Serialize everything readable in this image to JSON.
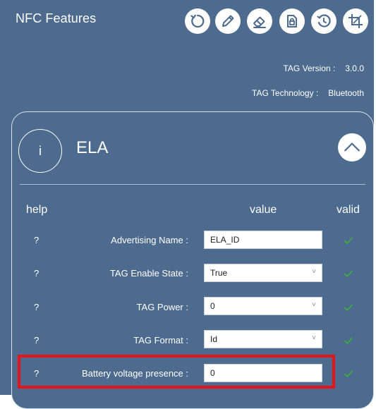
{
  "app": {
    "title": "NFC Features"
  },
  "toolbar": {
    "buttons": [
      {
        "icon": "refresh-icon"
      },
      {
        "icon": "pencil-icon"
      },
      {
        "icon": "eraser-icon"
      },
      {
        "icon": "lock-file-icon"
      },
      {
        "icon": "clock-refresh-icon"
      },
      {
        "icon": "crop-icon"
      }
    ]
  },
  "tag_info": {
    "version_label": "TAG Version :",
    "version_value": "3.0.0",
    "technology_label": "TAG Technology :",
    "technology_value": "Bluetooth"
  },
  "section": {
    "info_symbol": "i",
    "title": "ELA"
  },
  "columns": {
    "help": "help",
    "value": "value",
    "valid": "valid"
  },
  "rows": [
    {
      "help": "?",
      "label": "Advertising Name :",
      "value": "ELA_ID",
      "type": "input"
    },
    {
      "help": "?",
      "label": "TAG Enable State :",
      "value": "True",
      "type": "select"
    },
    {
      "help": "?",
      "label": "TAG Power :",
      "value": "0",
      "type": "select"
    },
    {
      "help": "?",
      "label": "TAG Format :",
      "value": "Id",
      "type": "select"
    },
    {
      "help": "?",
      "label": "Battery voltage presence :",
      "value": "0",
      "type": "input"
    }
  ],
  "colors": {
    "background": "#4d6b8e",
    "valid_check": "#3fb13b",
    "highlight": "#e8141b"
  }
}
